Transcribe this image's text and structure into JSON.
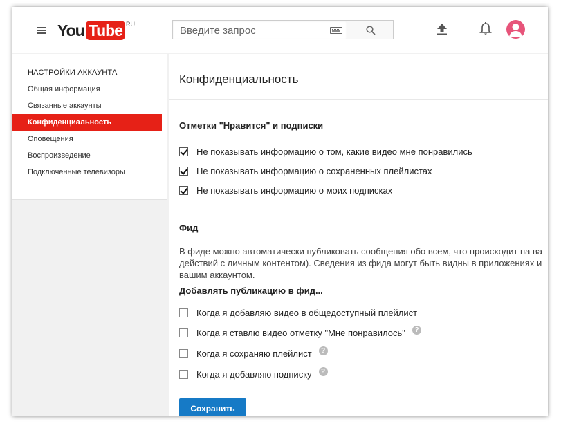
{
  "header": {
    "logo_you": "You",
    "logo_tube": "Tube",
    "logo_region": "RU",
    "search_placeholder": "Введите запрос"
  },
  "icons": {
    "menu": "hamburger-icon",
    "keyboard": "keyboard-icon",
    "search": "search-icon",
    "upload": "upload-icon",
    "notifications": "bell-icon",
    "avatar": "avatar-icon",
    "help": "help-icon"
  },
  "colors": {
    "brand_red": "#e62117",
    "button_blue": "#167ac6",
    "avatar_pink": "#e7547a"
  },
  "sidebar": {
    "title": "НАСТРОЙКИ АККАУНТА",
    "items": [
      {
        "label": "Общая информация",
        "active": false
      },
      {
        "label": "Связанные аккаунты",
        "active": false
      },
      {
        "label": "Конфиденциальность",
        "active": true
      },
      {
        "label": "Оповещения",
        "active": false
      },
      {
        "label": "Воспроизведение",
        "active": false
      },
      {
        "label": "Подключенные телевизоры",
        "active": false
      }
    ]
  },
  "main": {
    "title": "Конфиденциальность",
    "likes_section": {
      "title": "Отметки \"Нравится\" и подписки",
      "options": [
        {
          "label": "Не показывать информацию о том, какие видео мне понравились",
          "checked": true
        },
        {
          "label": "Не показывать информацию о сохраненных плейлистах",
          "checked": true
        },
        {
          "label": "Не показывать информацию о моих подписках",
          "checked": true
        }
      ]
    },
    "feed_section": {
      "title": "Фид",
      "description": "В фиде можно автоматически публиковать сообщения обо всем, что происходит на ва действий с личным контентом). Сведения из фида могут быть видны в приложениях и вашим аккаунтом.",
      "add_label": "Добавлять публикацию в фид...",
      "options": [
        {
          "label": "Когда я добавляю видео в общедоступный плейлист",
          "checked": false,
          "help": false
        },
        {
          "label": "Когда я ставлю видео отметку \"Мне понравилось\"",
          "checked": false,
          "help": true
        },
        {
          "label": "Когда я сохраняю плейлист",
          "checked": false,
          "help": true
        },
        {
          "label": "Когда я добавляю подписку",
          "checked": false,
          "help": true
        }
      ]
    },
    "help_glyph": "?",
    "save_label": "Сохранить"
  }
}
